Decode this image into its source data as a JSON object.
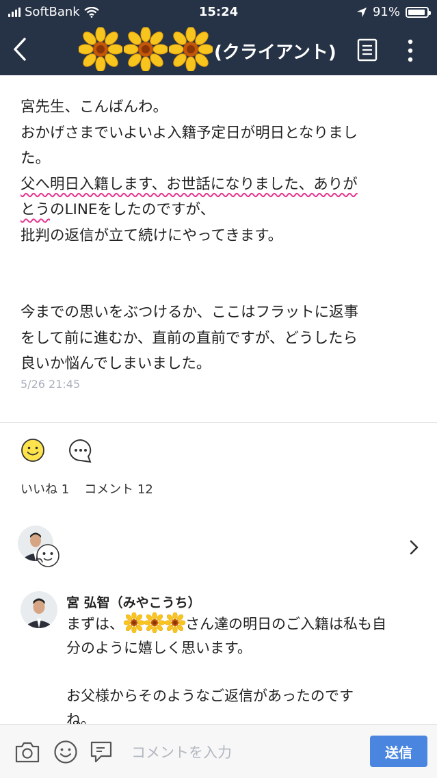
{
  "status_bar": {
    "carrier": "SoftBank",
    "time": "15:24",
    "battery": "91%",
    "battery_level": 0.91
  },
  "header": {
    "title": "(クライアント)",
    "flower_icon": "sunflower-emoji"
  },
  "post": {
    "lines": [
      "宮先生、こんばんわ。",
      "おかげさまでいよいよ入籍予定日が明日となりまし",
      "た。"
    ],
    "underlined_1": "父へ明日入籍します、お世話になりました、ありが",
    "underlined_2": "とう",
    "line_after_underline": "のLINEをしたのですが、",
    "line_5": "批判の返信が立て続けにやってきます。",
    "para2": [
      "今までの思いをぶつけるか、ここはフラットに返事",
      "をして前に進むか、直前の直前ですが、どうしたら",
      "良いか悩んでしまいました。"
    ],
    "timestamp": "5/26 21:45"
  },
  "reactions": {
    "likes_label": "いいね 1",
    "comments_label": "コメント 12"
  },
  "comment": {
    "author": "宮 弘智（みやこうち）",
    "line1_before": "まずは、",
    "line1_after": "さん達の明日のご入籍は私も自",
    "line2": "分のように嬉しく思います。",
    "line3": "お父様からそのようなご返信があったのです",
    "line4": "ね。"
  },
  "composer": {
    "placeholder": "コメントを入力",
    "send_label": "送信"
  },
  "colors": {
    "header_bg": "#263346",
    "accent": "#4a86e0",
    "underline": "#e6338e"
  }
}
